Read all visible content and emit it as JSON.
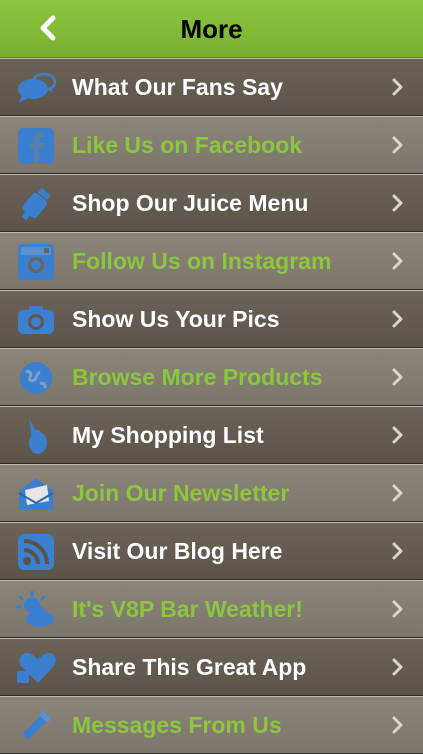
{
  "header": {
    "title": "More"
  },
  "colors": {
    "header_green": "#8cc63f",
    "accent_green": "#8cc63f",
    "row_dark": "#5f564c",
    "row_light": "#807a6f",
    "icon_blue": "#3a7fd0"
  },
  "menu": {
    "items": [
      {
        "label": "What Our Fans Say",
        "icon": "speech-bubbles-icon"
      },
      {
        "label": "Like Us on Facebook",
        "icon": "facebook-icon"
      },
      {
        "label": "Shop Our Juice Menu",
        "icon": "juice-bottle-icon"
      },
      {
        "label": "Follow Us on Instagram",
        "icon": "instagram-icon"
      },
      {
        "label": "Show Us Your Pics",
        "icon": "camera-icon"
      },
      {
        "label": "Browse More Products",
        "icon": "globe-icon"
      },
      {
        "label": "My Shopping List",
        "icon": "shopping-list-icon"
      },
      {
        "label": "Join Our Newsletter",
        "icon": "envelope-icon"
      },
      {
        "label": "Visit Our Blog Here",
        "icon": "rss-icon"
      },
      {
        "label": "It's V8P Bar Weather!",
        "icon": "weather-icon"
      },
      {
        "label": "Share This Great App",
        "icon": "heart-share-icon"
      },
      {
        "label": "Messages From Us",
        "icon": "megaphone-icon"
      }
    ]
  }
}
